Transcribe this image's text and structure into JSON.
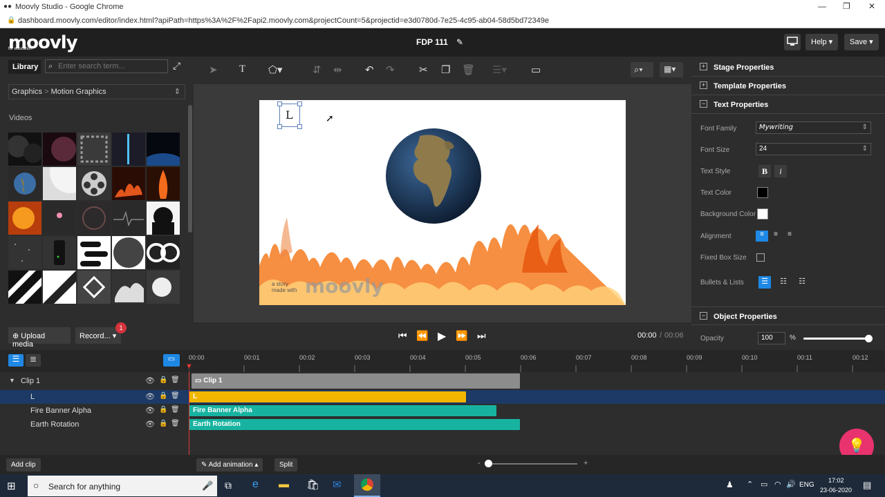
{
  "browser": {
    "title": "Moovly Studio - Google Chrome",
    "url": "dashboard.moovly.com/editor/index.html?apiPath=https%3A%2F%2Fapi2.moovly.com&projectCount=5&projectid=e3d0780d-7e25-4c95-ab04-58d5bd72349e"
  },
  "header": {
    "logo": "moovly",
    "logo_sub": "for education",
    "project_title": "FDP 111",
    "help_label": "Help",
    "save_label": "Save"
  },
  "library": {
    "tab_label": "Library",
    "search_placeholder": "Enter search term...",
    "breadcrumb": [
      "Graphics",
      "Motion Graphics"
    ],
    "section_title": "Videos",
    "upload_label": "Upload media",
    "record_label": "Record...",
    "record_badge": "1"
  },
  "stage": {
    "text_object": "L",
    "watermark_small": "a story made with",
    "watermark_logo": "moovly"
  },
  "player": {
    "current_time": "00:00",
    "separator": "/",
    "total_time": "00:06"
  },
  "properties": {
    "stage_title": "Stage Properties",
    "template_title": "Template Properties",
    "text_title": "Text Properties",
    "font_family_label": "Font Family",
    "font_family_value": "Mywriting",
    "font_size_label": "Font Size",
    "font_size_value": "24",
    "text_style_label": "Text Style",
    "bold_label": "B",
    "italic_label": "i",
    "text_color_label": "Text Color",
    "text_color": "#000000",
    "bg_color_label": "Background Color",
    "bg_color": "#ffffff",
    "alignment_label": "Alignment",
    "fixed_box_label": "Fixed Box Size",
    "bullets_label": "Bullets & Lists",
    "object_title": "Object Properties",
    "opacity_label": "Opacity",
    "opacity_value": "100",
    "opacity_unit": "%"
  },
  "timeline": {
    "ticks": [
      "00:00",
      "00:01",
      "00:02",
      "00:03",
      "00:04",
      "00:05",
      "00:06",
      "00:07",
      "00:08",
      "00:09",
      "00:10",
      "00:11",
      "00:12"
    ],
    "clip_label": "Clip 1",
    "clip_bar": "Clip 1",
    "rows": [
      {
        "label": "L",
        "bar": "L",
        "color": "#f2b600"
      },
      {
        "label": "Fire Banner Alpha",
        "bar": "Fire Banner Alpha",
        "color": "#17b3a0"
      },
      {
        "label": "Earth Rotation",
        "bar": "Earth Rotation",
        "color": "#17b3a0"
      }
    ],
    "add_clip": "Add clip",
    "add_animation": "Add animation",
    "split": "Split"
  },
  "taskbar": {
    "search": "Search for anything",
    "lang": "ENG",
    "time": "17:02",
    "date": "23-06-2020"
  },
  "colors": {
    "accent": "#1e88e5",
    "badge": "#d6333c",
    "fab": "#e8336e"
  }
}
